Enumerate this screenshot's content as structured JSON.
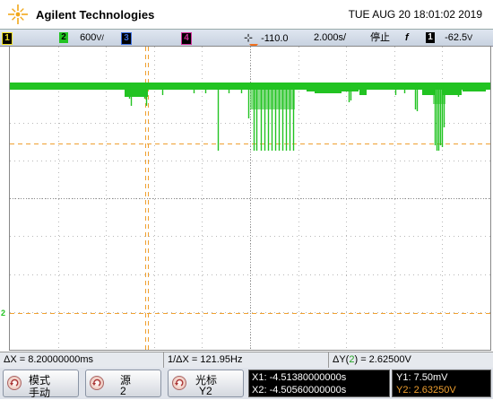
{
  "header": {
    "brand": "Agilent Technologies",
    "datetime": "TUE AUG 20 18:01:02 2019"
  },
  "status": {
    "ch1": "1",
    "ch2": "2",
    "ch2_scale": "600",
    "ch2_unit": "V/",
    "ch3": "3",
    "ch4": "4",
    "trigger_pos": "-110.0",
    "timebase": "2.000s/",
    "run_state": "停止",
    "trig_slope": "f",
    "trig_ch": "1",
    "trig_level": "-62.5",
    "trig_unit": "V"
  },
  "markers": {
    "ch2": "2"
  },
  "readout": {
    "dx": "ΔX = 8.20000000ms",
    "inv_dx": "1/ΔX = 121.95Hz",
    "dy_prefix": "ΔY(",
    "dy_ch": "2",
    "dy_suffix": ") = 2.62500V"
  },
  "softkeys": [
    {
      "line1": "模式",
      "line2": "手动"
    },
    {
      "line1": "源",
      "line2": "2"
    },
    {
      "line1": "光标",
      "line2": "Y2"
    }
  ],
  "cursors": {
    "x1": "X1: -4.51380000000s",
    "x2": "X2: -4.50560000000s",
    "y1": "Y1: 7.50mV",
    "y2": "Y2: 2.63250V"
  },
  "colors": {
    "ch1": "#f0e020",
    "ch2": "#22c322",
    "ch3": "#3d6fe0",
    "ch4": "#d0309a",
    "cursor": "#f0a030"
  }
}
